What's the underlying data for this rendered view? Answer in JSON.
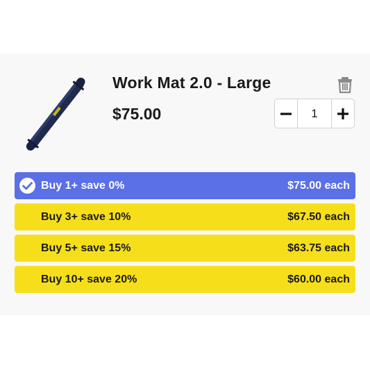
{
  "product": {
    "title": "Work Mat 2.0 - Large",
    "price": "$75.00",
    "image_icon": "rolled-mat-image"
  },
  "actions": {
    "remove_icon": "trash-icon"
  },
  "quantity": {
    "value": "1",
    "decrement_icon": "minus-icon",
    "increment_icon": "plus-icon"
  },
  "tiers": [
    {
      "label": "Buy 1+ save 0%",
      "price": "$75.00 each",
      "selected": true
    },
    {
      "label": "Buy 3+ save 10%",
      "price": "$67.50 each",
      "selected": false
    },
    {
      "label": "Buy 5+ save 15%",
      "price": "$63.75 each",
      "selected": false
    },
    {
      "label": "Buy 10+ save 20%",
      "price": "$60.00 each",
      "selected": false
    }
  ],
  "colors": {
    "selected_tier": "#5b6fe6",
    "tier": "#f6df1a",
    "panel": "#f8f8f8"
  }
}
